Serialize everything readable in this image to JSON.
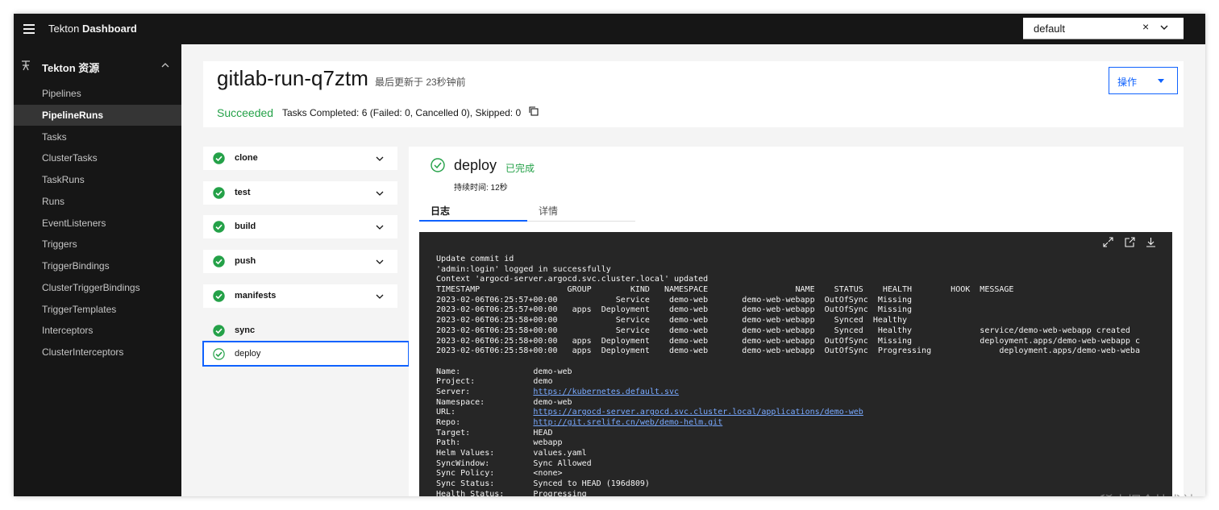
{
  "header": {
    "menu_icon": "hamburger-menu-icon",
    "app_name_prefix": "Tekton",
    "app_name_suffix": "Dashboard",
    "namespace_value": "default",
    "namespace_clear": "×",
    "namespace_caret": "chevron-down-icon"
  },
  "sidebar": {
    "section_label": "Tekton 资源",
    "section_icon": "tekton-icon",
    "items": [
      {
        "label": "Pipelines"
      },
      {
        "label": "PipelineRuns"
      },
      {
        "label": "Tasks"
      },
      {
        "label": "ClusterTasks"
      },
      {
        "label": "TaskRuns"
      },
      {
        "label": "Runs"
      },
      {
        "label": "EventListeners"
      },
      {
        "label": "Triggers"
      },
      {
        "label": "TriggerBindings"
      },
      {
        "label": "ClusterTriggerBindings"
      },
      {
        "label": "TriggerTemplates"
      },
      {
        "label": "Interceptors"
      },
      {
        "label": "ClusterInterceptors"
      }
    ],
    "active_item": "PipelineRuns"
  },
  "pipelinerun": {
    "name": "gitlab-run-q7ztm",
    "updated": "最后更新于 23秒钟前",
    "status": "Succeeded",
    "tasks_summary": "Tasks Completed: 6 (Failed: 0, Cancelled 0), Skipped: 0",
    "actions_label": "操作"
  },
  "tasks": [
    {
      "label": "clone"
    },
    {
      "label": "test"
    },
    {
      "label": "build"
    },
    {
      "label": "push"
    },
    {
      "label": "manifests"
    },
    {
      "label": "sync"
    },
    {
      "label": "deploy"
    }
  ],
  "step": {
    "name": "deploy",
    "status": "已完成",
    "duration": "持续时间: 12秒",
    "tabs": [
      {
        "label": "日志"
      },
      {
        "label": "详情"
      }
    ]
  },
  "log": {
    "lines": [
      "Update commit id",
      "'admin:login' logged in successfully",
      "Context 'argocd-server.argocd.svc.cluster.local' updated",
      "TIMESTAMP                  GROUP        KIND   NAMESPACE                  NAME    STATUS    HEALTH        HOOK  MESSAGE",
      "2023-02-06T06:25:57+00:00            Service    demo-web       demo-web-webapp  OutOfSync  Missing",
      "2023-02-06T06:25:57+00:00   apps  Deployment    demo-web       demo-web-webapp  OutOfSync  Missing",
      "2023-02-06T06:25:58+00:00            Service    demo-web       demo-web-webapp    Synced  Healthy",
      "2023-02-06T06:25:58+00:00            Service    demo-web       demo-web-webapp    Synced   Healthy              service/demo-web-webapp created",
      "2023-02-06T06:25:58+00:00   apps  Deployment    demo-web       demo-web-webapp  OutOfSync  Missing              deployment.apps/demo-web-webapp c",
      "2023-02-06T06:25:58+00:00   apps  Deployment    demo-web       demo-web-webapp  OutOfSync  Progressing              deployment.apps/demo-web-weba",
      "",
      "Name:               demo-web",
      "Project:            demo",
      "Server:             ",
      "Namespace:          demo-web",
      "URL:                ",
      "Repo:               ",
      "Target:             HEAD",
      "Path:               webapp",
      "Helm Values:        values.yaml",
      "SyncWindow:         Sync Allowed",
      "Sync Policy:        <none>",
      "Sync Status:        Synced to HEAD (196d809)",
      "Health Status:      Progressing"
    ],
    "server_link": "https://kubernetes.default.svc",
    "url_link": "https://argocd-server.argocd.svc.cluster.local/applications/demo-web",
    "repo_link": "http://git.srelife.cn/web/demo-helm.git"
  },
  "watermark": "@稀土掘金技术社区",
  "colors": {
    "success": "#24a148",
    "accent": "#0f62fe",
    "header_bg": "#161616",
    "log_bg": "#262626"
  }
}
